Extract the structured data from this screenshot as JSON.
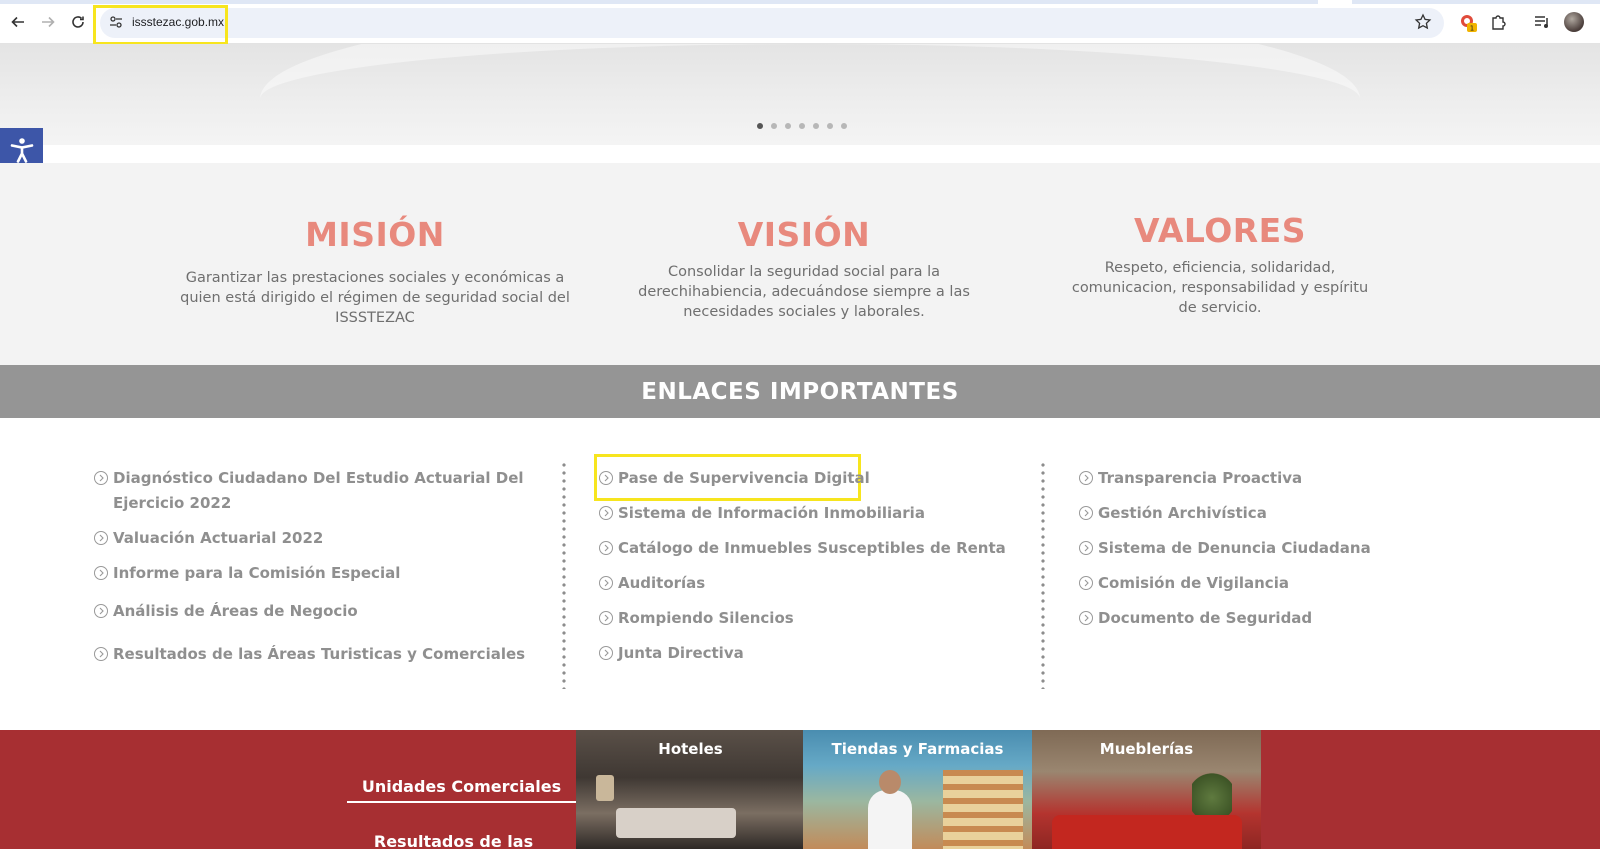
{
  "browser": {
    "url": "issstezac.gob.mx",
    "extension_badge": "1"
  },
  "hero": {
    "dots_count": 7,
    "active_dot": 1
  },
  "mission": {
    "title": "MISIÓN",
    "text": "Garantizar las prestaciones sociales y económicas a quien está dirigido el régimen de seguridad social del ISSSTEZAC"
  },
  "vision": {
    "title": "VISIÓN",
    "text": "Consolidar la seguridad social para la derechihabiencia, adecuándose siempre a las necesidades sociales y laborales."
  },
  "values": {
    "title": "VALORES",
    "text": "Respeto, eficiencia, solidaridad, comunicacion, responsabilidad y espíritu de servicio."
  },
  "enlaces": {
    "heading": "ENLACES IMPORTANTES",
    "col1": [
      "Diagnóstico Ciudadano Del Estudio Actuarial Del Ejercicio 2022",
      "Valuación Actuarial 2022",
      "Informe para la Comisión Especial",
      "Análisis de Áreas de Negocio",
      "Resultados de las Áreas Turisticas y Comerciales"
    ],
    "col2": [
      "Pase de Supervivencia Digital",
      "Sistema de Información Inmobiliaria",
      "Catálogo de Inmuebles Susceptibles de Renta",
      "Auditorías",
      "Rompiendo Silencios",
      "Junta Directiva"
    ],
    "col3": [
      "Transparencia Proactiva",
      "Gestión Archivística",
      "Sistema de Denuncia Ciudadana",
      "Comisión de Vigilancia",
      "Documento de Seguridad"
    ]
  },
  "bottom": {
    "unidades_label": "Unidades Comerciales",
    "resultados_label": "Resultados de las",
    "tiles": [
      "Hoteles",
      "Tiendas y Farmacias",
      "Mueblerías"
    ]
  },
  "colors": {
    "accent_title": "#e8897d",
    "bar_gray": "#959595",
    "bottom_red": "#a72f32",
    "highlight": "#f7e51e",
    "accessibility_blue": "#3d56a8"
  }
}
